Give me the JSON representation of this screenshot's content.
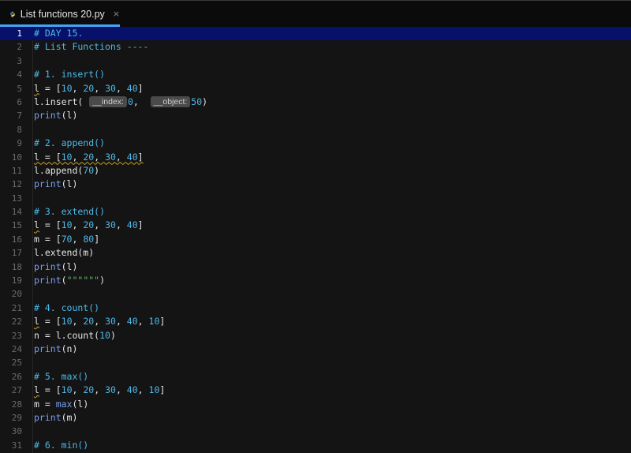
{
  "tab": {
    "filename": "List functions 20.py",
    "close_glyph": "×",
    "icon": "python-file-icon"
  },
  "hints": {
    "index": "__index:",
    "object": "__object:"
  },
  "code": {
    "l1": "# DAY 15.",
    "l2": "# List Functions ----",
    "l4": "# 1. insert()",
    "l9": "# 2. append()",
    "l14": "# 3. extend()",
    "l21": "# 4. count()",
    "l26": "# 5. max()",
    "l31": "# 6. min()",
    "l19_str": "\"\"\"\"\"\""
  },
  "line_numbers": [
    "1",
    "2",
    "3",
    "4",
    "5",
    "6",
    "7",
    "8",
    "9",
    "10",
    "11",
    "12",
    "13",
    "14",
    "15",
    "16",
    "17",
    "18",
    "19",
    "20",
    "21",
    "22",
    "23",
    "24",
    "25",
    "26",
    "27",
    "28",
    "29",
    "30",
    "31"
  ],
  "colors": {
    "current_line": "#07116a",
    "tab_accent": "#42a5f5",
    "comment": "#4fb8e8",
    "number": "#4fb8e8",
    "builtin": "#7a9ef0",
    "string": "#67b86b"
  }
}
